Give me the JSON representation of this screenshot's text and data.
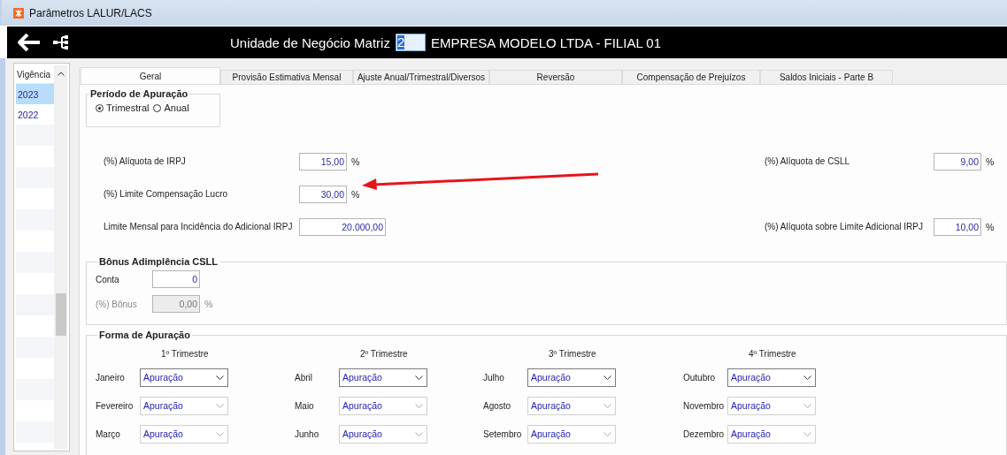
{
  "window": {
    "title": "Parâmetros LALUR/LACS"
  },
  "header": {
    "label": "Unidade de Negócio Matriz",
    "unit_code": "2",
    "company": "EMPRESA MODELO LTDA - FILIAL 01"
  },
  "sidebar": {
    "column": "Vigência",
    "items": [
      {
        "label": "2023",
        "selected": true
      },
      {
        "label": "2022",
        "selected": false
      }
    ]
  },
  "tabs": [
    {
      "label": "Geral",
      "selected": true
    },
    {
      "label": "Provisão Estimativa Mensal",
      "selected": false
    },
    {
      "label": "Ajuste Anual/Trimestral/Diversos",
      "selected": false
    },
    {
      "label": "Reversão",
      "selected": false
    },
    {
      "label": "Compensação de Prejuízos",
      "selected": false
    },
    {
      "label": "Saldos Iniciais - Parte B",
      "selected": false
    }
  ],
  "periodo": {
    "title": "Período de Apuração",
    "options": [
      {
        "label": "Trimestral",
        "selected": true
      },
      {
        "label": "Anual",
        "selected": false
      }
    ]
  },
  "rate_rows": [
    {
      "left": {
        "label": "(%) Alíquota de IRPJ",
        "value": "15,00",
        "unit": "%"
      },
      "right": {
        "label": "(%) Alíquota de CSLL",
        "value": "9,00",
        "unit": "%"
      }
    },
    {
      "left": {
        "label": "(%) Limite Compensação Lucro",
        "value": "30,00",
        "unit": "%"
      }
    },
    {
      "left": {
        "label": "Limite Mensal para Incidência do Adicional IRPJ",
        "value": "20.000,00"
      },
      "right": {
        "label": "(%) Alíquota sobre Limite Adicional IRPJ",
        "value": "10,00",
        "unit": "%"
      }
    }
  ],
  "bonus": {
    "title": "Bônus Adimplência CSLL",
    "fields": [
      {
        "label": "Conta",
        "value": "0",
        "disabled": false
      },
      {
        "label": "(%) Bônus",
        "value": "0,00",
        "unit": "%",
        "disabled": true
      }
    ]
  },
  "forma": {
    "title": "Forma de Apuração",
    "quarters": [
      {
        "title": "1º Trimestre",
        "months": [
          {
            "label": "Janeiro",
            "value": "Apuração",
            "disabled": false
          },
          {
            "label": "Fevereiro",
            "value": "Apuração",
            "disabled": true
          },
          {
            "label": "Março",
            "value": "Apuração",
            "disabled": true
          }
        ]
      },
      {
        "title": "2º Trimestre",
        "months": [
          {
            "label": "Abril",
            "value": "Apuração",
            "disabled": false
          },
          {
            "label": "Maio",
            "value": "Apuração",
            "disabled": true
          },
          {
            "label": "Junho",
            "value": "Apuração",
            "disabled": true
          }
        ]
      },
      {
        "title": "3º Trimestre",
        "months": [
          {
            "label": "Julho",
            "value": "Apuração",
            "disabled": false
          },
          {
            "label": "Agosto",
            "value": "Apuração",
            "disabled": true
          },
          {
            "label": "Setembro",
            "value": "Apuração",
            "disabled": true
          }
        ]
      },
      {
        "title": "4º Trimestre",
        "months": [
          {
            "label": "Outubro",
            "value": "Apuração",
            "disabled": false
          },
          {
            "label": "Novembro",
            "value": "Apuração",
            "disabled": true
          },
          {
            "label": "Dezembro",
            "value": "Apuração",
            "disabled": true
          }
        ]
      }
    ]
  }
}
